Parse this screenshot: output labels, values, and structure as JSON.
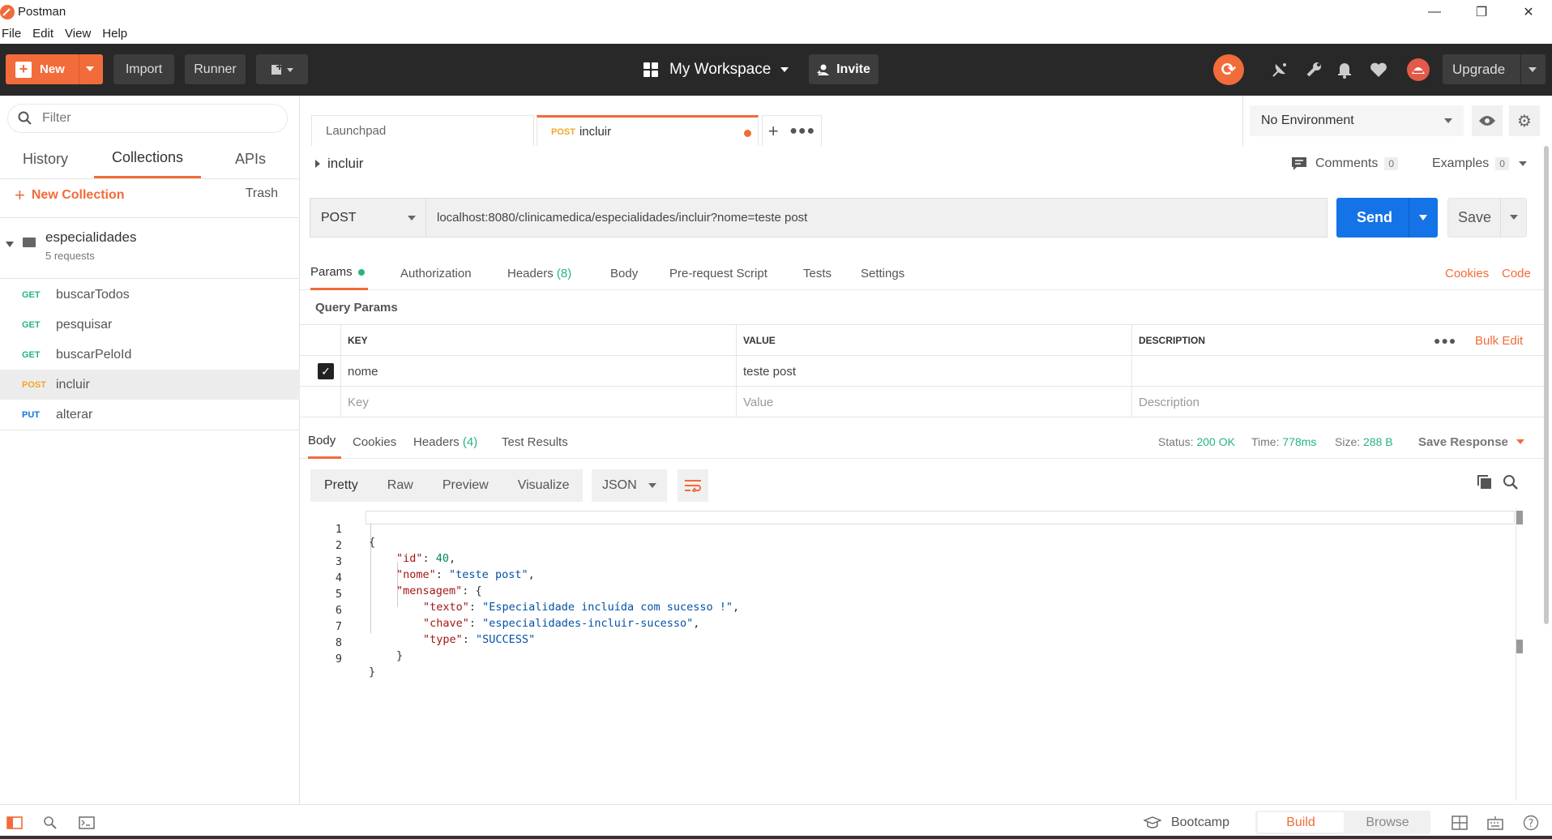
{
  "window": {
    "title": "Postman",
    "menu": [
      "File",
      "Edit",
      "View",
      "Help"
    ]
  },
  "header": {
    "new_label": "New",
    "import_label": "Import",
    "runner_label": "Runner",
    "workspace_label": "My Workspace",
    "invite_label": "Invite",
    "upgrade_label": "Upgrade",
    "accent_color": "#f26b3a"
  },
  "sidebar": {
    "filter_placeholder": "Filter",
    "tabs": [
      "History",
      "Collections",
      "APIs"
    ],
    "active_tab": "Collections",
    "new_collection_label": "New Collection",
    "trash_label": "Trash",
    "collection": {
      "name": "especialidades",
      "count": "5 requests",
      "requests": [
        {
          "method": "GET",
          "name": "buscarTodos",
          "color": "#26b47f"
        },
        {
          "method": "GET",
          "name": "pesquisar",
          "color": "#26b47f"
        },
        {
          "method": "GET",
          "name": "buscarPeloId",
          "color": "#26b47f"
        },
        {
          "method": "POST",
          "name": "incluir",
          "color": "#f5a623",
          "selected": true
        },
        {
          "method": "PUT",
          "name": "alterar",
          "color": "#1473e6"
        }
      ]
    }
  },
  "tabs": {
    "launchpad": "Launchpad",
    "active_method": "POST",
    "active_name": "incluir"
  },
  "environment": {
    "selected": "No Environment"
  },
  "request": {
    "name": "incluir",
    "comments_label": "Comments",
    "comments_count": "0",
    "examples_label": "Examples",
    "examples_count": "0",
    "method": "POST",
    "url": "localhost:8080/clinicamedica/especialidades/incluir?nome=teste post",
    "send_label": "Send",
    "save_label": "Save",
    "tabs": {
      "params": "Params",
      "authorization": "Authorization",
      "headers": "Headers",
      "headers_count": "(8)",
      "body": "Body",
      "prerequest": "Pre-request Script",
      "tests": "Tests",
      "settings": "Settings"
    },
    "cookies_label": "Cookies",
    "code_label": "Code",
    "query_params_title": "Query Params",
    "params_table": {
      "headers": [
        "KEY",
        "VALUE",
        "DESCRIPTION"
      ],
      "bulk_edit": "Bulk Edit",
      "rows": [
        {
          "key": "nome",
          "value": "teste post",
          "description": "",
          "checked": true
        }
      ],
      "placeholders": {
        "key": "Key",
        "value": "Value",
        "description": "Description"
      }
    }
  },
  "response": {
    "tabs": {
      "body": "Body",
      "cookies": "Cookies",
      "headers": "Headers",
      "headers_count": "(4)",
      "test_results": "Test Results"
    },
    "status_label": "Status:",
    "status_value": "200 OK",
    "time_label": "Time:",
    "time_value": "778ms",
    "size_label": "Size:",
    "size_value": "288 B",
    "save_response_label": "Save Response",
    "view_tabs": [
      "Pretty",
      "Raw",
      "Preview",
      "Visualize"
    ],
    "format": "JSON",
    "lines": [
      "1",
      "2",
      "3",
      "4",
      "5",
      "6",
      "7",
      "8",
      "9"
    ],
    "body": {
      "open": "{",
      "id_key": "\"id\"",
      "id_val": "40",
      "nome_key": "\"nome\"",
      "nome_val": "\"teste post\"",
      "mensagem_key": "\"mensagem\"",
      "texto_key": "\"texto\"",
      "texto_val": "\"Especialidade incluída com sucesso !\"",
      "chave_key": "\"chave\"",
      "chave_val": "\"especialidades-incluir-sucesso\"",
      "type_key": "\"type\"",
      "type_val": "\"SUCCESS\"",
      "inner_close": "}",
      "close": "}"
    }
  },
  "statusbar": {
    "bootcamp_label": "Bootcamp",
    "build_label": "Build",
    "browse_label": "Browse"
  }
}
